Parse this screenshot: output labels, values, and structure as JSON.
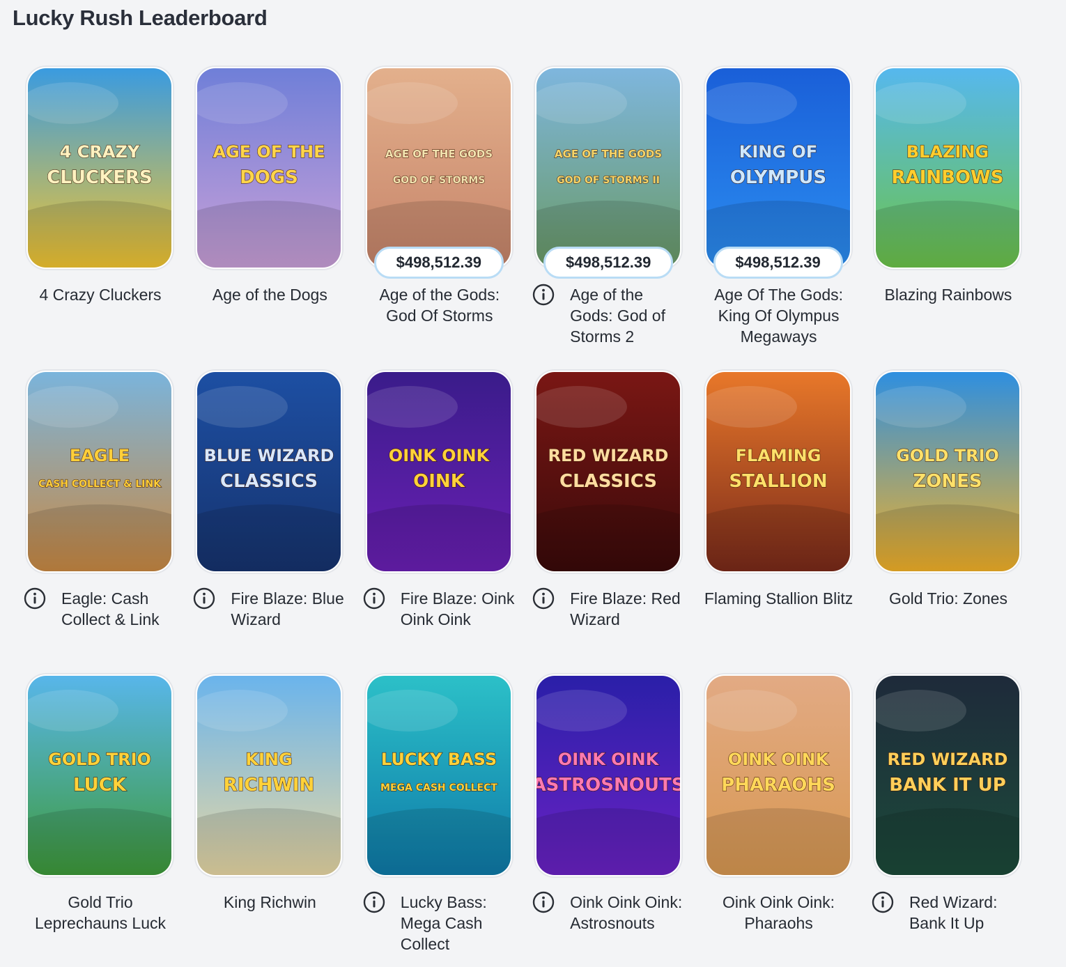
{
  "page": {
    "title": "Lucky Rush Leaderboard"
  },
  "games": [
    {
      "title": "4 Crazy Cluckers",
      "jackpot": "",
      "info": false,
      "logo": [
        "4 CRAZY",
        "CLUCKERS"
      ],
      "colors": {
        "top": "#3a9be0",
        "bottom": "#f2c531",
        "text": "#fff2c0"
      }
    },
    {
      "title": "Age of the Dogs",
      "jackpot": "",
      "info": false,
      "logo": [
        "AGE OF THE",
        "DOGS"
      ],
      "colors": {
        "top": "#6f7fd8",
        "bottom": "#c9a0d8",
        "text": "#ffd54a"
      }
    },
    {
      "title": "Age of the Gods: God Of Storms",
      "jackpot": "$498,512.39",
      "info": false,
      "logo": [
        "AGE OF THE GODS",
        "GOD OF STORMS"
      ],
      "colors": {
        "top": "#e3b08c",
        "bottom": "#c6846a",
        "text": "#f3e4b0"
      }
    },
    {
      "title": "Age of the Gods: God of Storms 2",
      "jackpot": "$498,512.39",
      "info": true,
      "logo": [
        "AGE OF THE GODS",
        "GOD OF STORMS II"
      ],
      "colors": {
        "top": "#7eb6de",
        "bottom": "#6a9a66",
        "text": "#f5d56a"
      }
    },
    {
      "title": "Age Of The Gods: King Of Olympus Megaways",
      "jackpot": "$498,512.39",
      "info": false,
      "logo": [
        "KING OF",
        "OLYMPUS"
      ],
      "colors": {
        "top": "#1a5fd8",
        "bottom": "#2b8df0",
        "text": "#cfe8ff"
      }
    },
    {
      "title": "Blazing Rainbows",
      "jackpot": "",
      "info": false,
      "logo": [
        "BLAZING",
        "RAINBOWS"
      ],
      "colors": {
        "top": "#56b8ee",
        "bottom": "#6cc34a",
        "text": "#ffce2e"
      }
    },
    {
      "title": "Eagle: Cash Collect & Link",
      "jackpot": "",
      "info": true,
      "logo": [
        "EAGLE",
        "CASH COLLECT & LINK"
      ],
      "colors": {
        "top": "#7ab4dc",
        "bottom": "#c98943",
        "text": "#ffcf3a"
      }
    },
    {
      "title": "Fire Blaze: Blue Wizard",
      "jackpot": "",
      "info": true,
      "logo": [
        "BLUE WIZARD",
        "CLASSICS"
      ],
      "colors": {
        "top": "#1d4fa3",
        "bottom": "#16336e",
        "text": "#d9e8ff"
      }
    },
    {
      "title": "Fire Blaze: Oink Oink Oink",
      "jackpot": "",
      "info": true,
      "logo": [
        "OINK OINK",
        "OINK"
      ],
      "colors": {
        "top": "#3a1c8a",
        "bottom": "#6a1fb4",
        "text": "#ffd23a"
      }
    },
    {
      "title": "Fire Blaze: Red Wizard",
      "jackpot": "",
      "info": true,
      "logo": [
        "RED WIZARD",
        "CLASSICS"
      ],
      "colors": {
        "top": "#7a1714",
        "bottom": "#3a0a0a",
        "text": "#ffdca0"
      }
    },
    {
      "title": "Flaming Stallion Blitz",
      "jackpot": "",
      "info": false,
      "logo": [
        "FLAMING",
        "STALLION"
      ],
      "colors": {
        "top": "#e8782a",
        "bottom": "#7a2a1a",
        "text": "#ffe06a"
      }
    },
    {
      "title": "Gold Trio: Zones",
      "jackpot": "",
      "info": false,
      "logo": [
        "GOLD TRIO",
        "ZONES"
      ],
      "colors": {
        "top": "#2e8fe0",
        "bottom": "#f2b128",
        "text": "#ffe16a"
      }
    },
    {
      "title": "Gold Trio Leprechauns Luck",
      "jackpot": "",
      "info": false,
      "logo": [
        "GOLD TRIO",
        "LUCK"
      ],
      "colors": {
        "top": "#58b6ea",
        "bottom": "#3e9a3a",
        "text": "#ffd23a"
      }
    },
    {
      "title": "King Richwin",
      "jackpot": "",
      "info": false,
      "logo": [
        "KING",
        "RICHWIN"
      ],
      "colors": {
        "top": "#6ab4ec",
        "bottom": "#e7d7a4",
        "text": "#ffd23a"
      }
    },
    {
      "title": "Lucky Bass: Mega Cash Collect",
      "jackpot": "",
      "info": true,
      "logo": [
        "LUCKY BASS",
        "MEGA CASH COLLECT"
      ],
      "colors": {
        "top": "#2cc0c8",
        "bottom": "#0e7aa8",
        "text": "#ffd23a"
      }
    },
    {
      "title": "Oink Oink Oink: Astrosnouts",
      "jackpot": "",
      "info": true,
      "logo": [
        "OINK OINK",
        "ASTROSNOUTS"
      ],
      "colors": {
        "top": "#2a1fa8",
        "bottom": "#6a22c4",
        "text": "#ff7ab0"
      }
    },
    {
      "title": "Oink Oink Oink: Pharaohs",
      "jackpot": "",
      "info": false,
      "logo": [
        "OINK OINK",
        "PHARAOHS"
      ],
      "colors": {
        "top": "#e2aa84",
        "bottom": "#d89852",
        "text": "#ffd85a"
      }
    },
    {
      "title": "Red Wizard: Bank It Up",
      "jackpot": "",
      "info": true,
      "logo": [
        "RED WIZARD",
        "BANK IT UP"
      ],
      "colors": {
        "top": "#1e2a3a",
        "bottom": "#1c4a3a",
        "text": "#ffcf5a"
      }
    }
  ]
}
